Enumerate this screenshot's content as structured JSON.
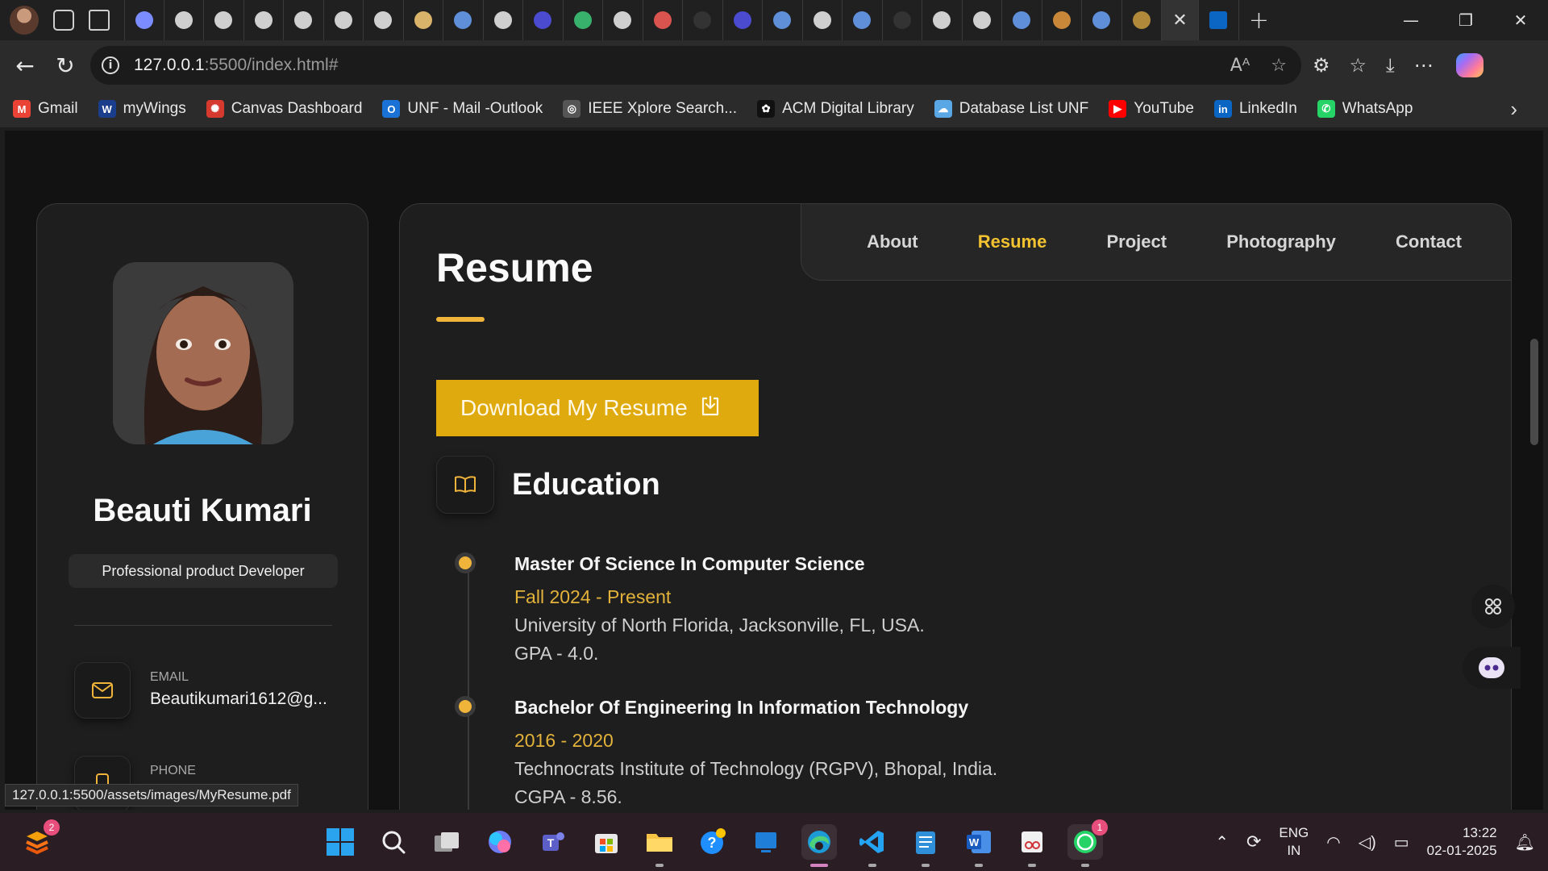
{
  "browser": {
    "url_host": "127.0.0.1",
    "url_rest": ":5500/index.html#",
    "tabs_count": 30,
    "bookmarks": [
      {
        "label": "Gmail",
        "color": "#ea4335",
        "glyph": "M"
      },
      {
        "label": "myWings",
        "color": "#1a3e8c",
        "glyph": "W"
      },
      {
        "label": "Canvas Dashboard",
        "color": "#d63a2f",
        "glyph": "✺"
      },
      {
        "label": "UNF - Mail -Outlook",
        "color": "#1b72d6",
        "glyph": "O"
      },
      {
        "label": "IEEE Xplore Search...",
        "color": "#555555",
        "glyph": "◎"
      },
      {
        "label": "ACM Digital Library",
        "color": "#111111",
        "glyph": "✿"
      },
      {
        "label": "Database List UNF",
        "color": "#5aa7e6",
        "glyph": "☁"
      },
      {
        "label": "YouTube",
        "color": "#ff0000",
        "glyph": "▶"
      },
      {
        "label": "LinkedIn",
        "color": "#0a66c2",
        "glyph": "in"
      },
      {
        "label": "WhatsApp",
        "color": "#25d366",
        "glyph": "✆"
      }
    ]
  },
  "profile": {
    "name": "Beauti Kumari",
    "title": "Professional product Developer",
    "contacts": [
      {
        "label": "EMAIL",
        "value": "Beautikumari1612@g..."
      },
      {
        "label": "PHONE",
        "value": ""
      }
    ]
  },
  "nav": [
    "About",
    "Resume",
    "Project",
    "Photography",
    "Contact"
  ],
  "nav_active": "Resume",
  "resume": {
    "title": "Resume",
    "download_label": "Download My Resume",
    "education_title": "Education",
    "education": [
      {
        "degree": "Master Of Science In Computer Science",
        "period": "Fall 2024 - Present",
        "school": "University of North Florida, Jacksonville, FL, USA.",
        "grade": "GPA - 4.0."
      },
      {
        "degree": "Bachelor Of Engineering In Information Technology",
        "period": "2016 - 2020",
        "school": "Technocrats Institute of Technology (RGPV), Bhopal, India.",
        "grade": "CGPA - 8.56."
      }
    ]
  },
  "status_url": "127.0.0.1:5500/assets/images/MyResume.pdf",
  "taskbar": {
    "lang1": "ENG",
    "lang2": "IN",
    "time": "13:22",
    "date": "02-01-2025",
    "badge_left": "2",
    "badge_whatsapp": "1"
  },
  "colors": {
    "accent": "#f2c230",
    "button": "#dfaa0d"
  }
}
